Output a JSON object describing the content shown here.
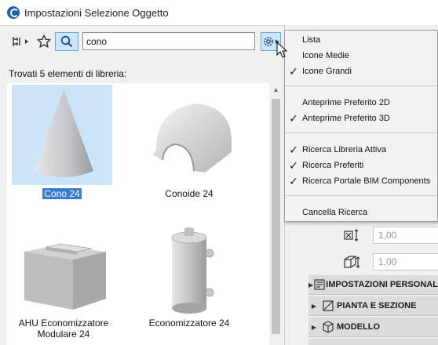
{
  "window": {
    "title": "Impostazioni Selezione Oggetto"
  },
  "toolbar": {
    "search_value": "cono",
    "search_placeholder": ""
  },
  "results": {
    "found_label": "Trovati 5 elementi di libreria:",
    "items": [
      {
        "name": "Cono 24",
        "selected": true
      },
      {
        "name": "Conoide 24",
        "selected": false
      },
      {
        "name": "AHU Economizzatore Modulare 24",
        "line1": "AHU Economizzatore",
        "line2": "Modulare 24",
        "selected": false
      },
      {
        "name": "Economizzatore 24",
        "selected": false
      }
    ]
  },
  "menu": {
    "items": [
      {
        "label": "Lista",
        "checked": false
      },
      {
        "label": "Icone Medie",
        "checked": false
      },
      {
        "label": "Icone Grandi",
        "checked": true
      },
      {
        "label": "Anteprime Preferito 2D",
        "checked": false
      },
      {
        "label": "Anteprime Preferito 3D",
        "checked": true
      },
      {
        "label": "Ricerca Libreria Attiva",
        "checked": true
      },
      {
        "label": "Ricerca Preferiti",
        "checked": true
      },
      {
        "label": "Ricerca Portale BIM Components",
        "checked": true
      },
      {
        "label": "Cancella Ricerca",
        "checked": false
      }
    ]
  },
  "properties": {
    "width_value": "1,00",
    "height_value": "1,00",
    "sections": [
      {
        "label": "IMPOSTAZIONI PERSONALIZZATE"
      },
      {
        "label": "PIANTA E SEZIONE"
      },
      {
        "label": "MODELLO"
      }
    ]
  },
  "colors": {
    "selection": "#3a7bd5",
    "thumb_selected": "#cce4f7",
    "accent_button": "#cfe5fb"
  }
}
